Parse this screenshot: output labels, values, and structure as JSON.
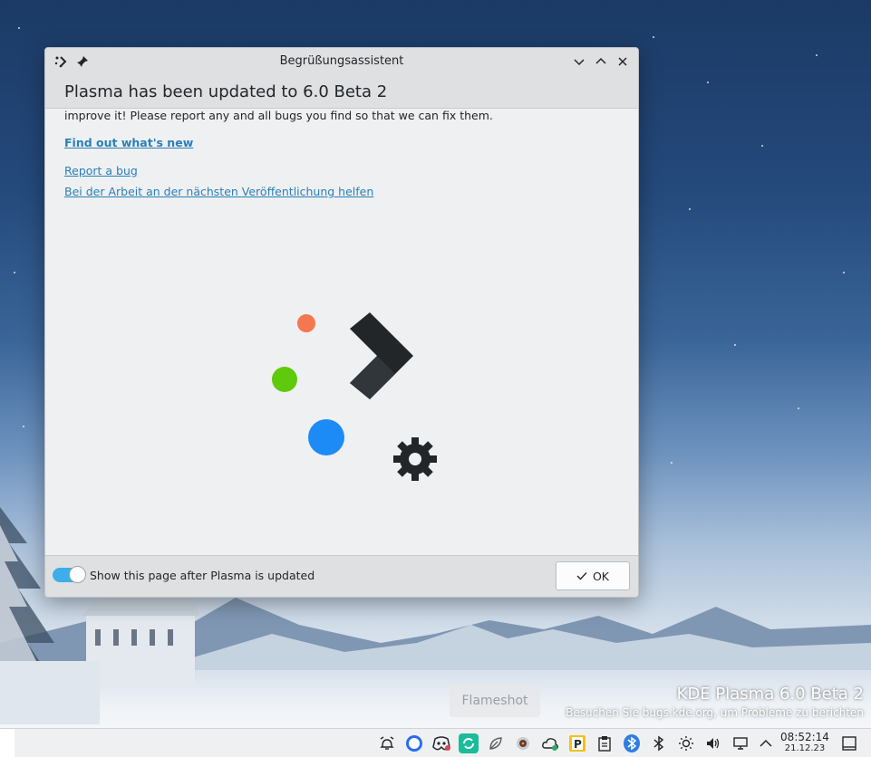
{
  "window": {
    "title": "Begrüßungsassistent",
    "header_title": "Plasma has been updated to 6.0 Beta 2",
    "intro_text": "improve it! Please report any and all bugs you find so that we can fix them.",
    "links": {
      "whats_new": "Find out what's new",
      "report_bug": "Report a bug",
      "help_next": "Bei der Arbeit an der nächsten Veröffentlichung helfen"
    },
    "footer": {
      "toggle_label": "Show this page after Plasma is updated",
      "toggle_on": true,
      "ok_label": "OK"
    }
  },
  "tooltip": "Flameshot",
  "watermark": {
    "line1": "KDE Plasma 6.0 Beta 2",
    "line2": "Besuchen Sie bugs.kde.org, um Probleme zu berichten"
  },
  "panel": {
    "tray_icons": [
      "alarm-icon",
      "circle-app-icon",
      "discord-icon",
      "sync-app-icon",
      "leaf-icon",
      "media-icon",
      "cloud-icon",
      "p-app-icon",
      "clipboard-icon",
      "bluetooth-badge-icon",
      "bluetooth-icon",
      "brightness-icon",
      "volume-icon",
      "network-icon",
      "show-more-icon"
    ],
    "clock_time": "08:52:14",
    "clock_date": "21.12.23"
  },
  "colors": {
    "accent": "#3daee9",
    "link": "#2980b9",
    "logo_orange": "#f47750",
    "logo_green": "#5fc90c",
    "logo_blue": "#1d8bf5",
    "logo_dark": "#232629"
  }
}
